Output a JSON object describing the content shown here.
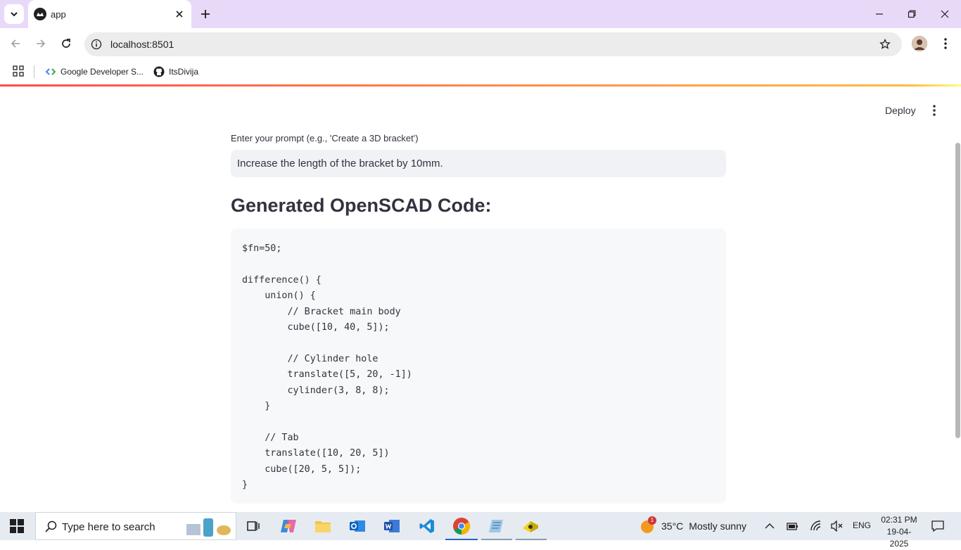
{
  "browser": {
    "tab_title": "app",
    "url": "localhost:8501",
    "bookmarks": [
      {
        "label": "Google Developer S...",
        "icon": "google-developers-icon"
      },
      {
        "label": "ItsDivija",
        "icon": "github-icon"
      }
    ]
  },
  "app": {
    "deploy_label": "Deploy",
    "prompt_label": "Enter your prompt (e.g., 'Create a 3D bracket')",
    "prompt_value": "Increase the length of the bracket by 10mm.",
    "heading": "Generated OpenSCAD Code:",
    "code": "$fn=50;\n\ndifference() {\n    union() {\n        // Bracket main body\n        cube([10, 40, 5]);\n\n        // Cylinder hole\n        translate([5, 20, -1])\n        cylinder(3, 8, 8);\n    }\n\n    // Tab\n    translate([10, 20, 5])\n    cube([20, 5, 5]);\n}"
  },
  "taskbar": {
    "search_placeholder": "Type here to search",
    "weather_temp": "35°C",
    "weather_desc": "Mostly sunny",
    "weather_badge": "1",
    "language": "ENG",
    "time": "02:31 PM",
    "date": "19-04-2025"
  },
  "colors": {
    "tabstrip": "#e9d9f9",
    "accent_red": "#ff4b4b",
    "text": "#31333f"
  }
}
